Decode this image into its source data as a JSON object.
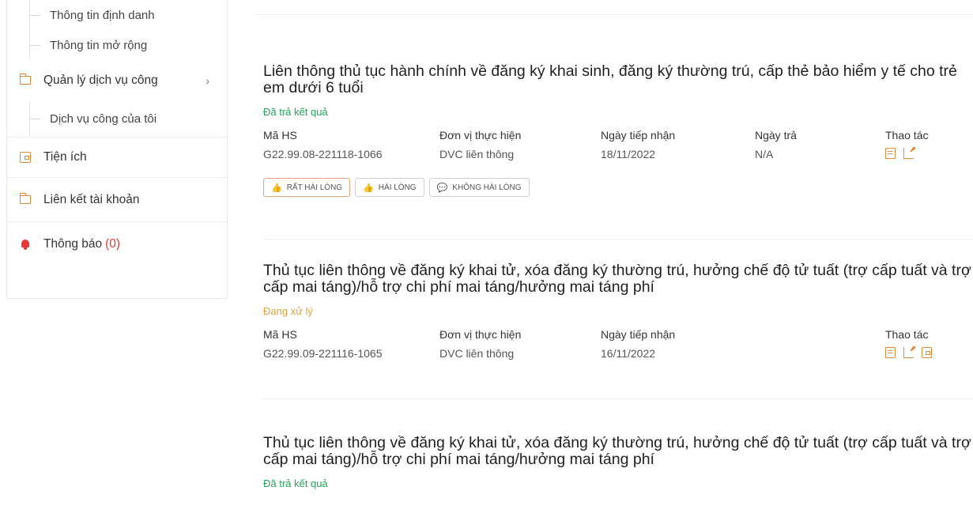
{
  "sidebar": {
    "sub_items_top": [
      {
        "label": "Thông tin định danh"
      },
      {
        "label": "Thông tin mở rộng"
      }
    ],
    "manage": {
      "label": "Quản lý dịch vụ công",
      "chevron": "›",
      "icon": "folder-icon"
    },
    "my_services": {
      "label": "Dịch vụ công của tôi"
    },
    "utilities": {
      "label": "Tiện ích",
      "icon": "wallet-icon"
    },
    "linked": {
      "label": "Liên kết tài khoản",
      "icon": "folder-icon"
    },
    "notifications": {
      "label": "Thông báo",
      "count": "(0)",
      "icon": "bell-icon"
    }
  },
  "columns": {
    "code": "Mã HS",
    "unit": "Đơn vị thực hiện",
    "received": "Ngày tiếp nhận",
    "returned": "Ngày trả",
    "actions": "Thao tác"
  },
  "records": [
    {
      "title": "Liên thông thủ tục hành chính về đăng ký khai sinh, đăng ký thường trú, cấp thẻ bảo hiểm y tế cho trẻ em dưới 6 tuổi",
      "status": "Đã trả kết quả",
      "code": "G22.99.08-221118-1066",
      "unit": "DVC liên thông",
      "received": "18/11/2022",
      "returned": "N/A"
    },
    {
      "title": "Thủ tục liên thông về đăng ký khai tử, xóa đăng ký thường trú, hưởng chế độ tử tuất (trợ cấp tuất và trợ cấp mai táng)/hỗ trợ chi phí mai táng/hưởng mai táng phí",
      "status": "Đang xử lý",
      "code": "G22.99.09-221116-1065",
      "unit": "DVC liên thông",
      "received": "16/11/2022"
    },
    {
      "title": "Thủ tục liên thông về đăng ký khai tử, xóa đăng ký thường trú, hưởng chế độ tử tuất (trợ cấp tuất và trợ cấp mai táng)/hỗ trợ chi phí mai táng/hưởng mai táng phí",
      "status": "Đã trả kết quả"
    }
  ],
  "rating": {
    "very_satisfied": "RẤT HÀI LÒNG",
    "satisfied": "HÀI LÒNG",
    "unsatisfied": "KHÔNG HÀI LÒNG"
  },
  "colors": {
    "accent": "#e0893b",
    "status_done": "#27a35a",
    "status_processing": "#e6a23c",
    "notification": "#e53935"
  }
}
